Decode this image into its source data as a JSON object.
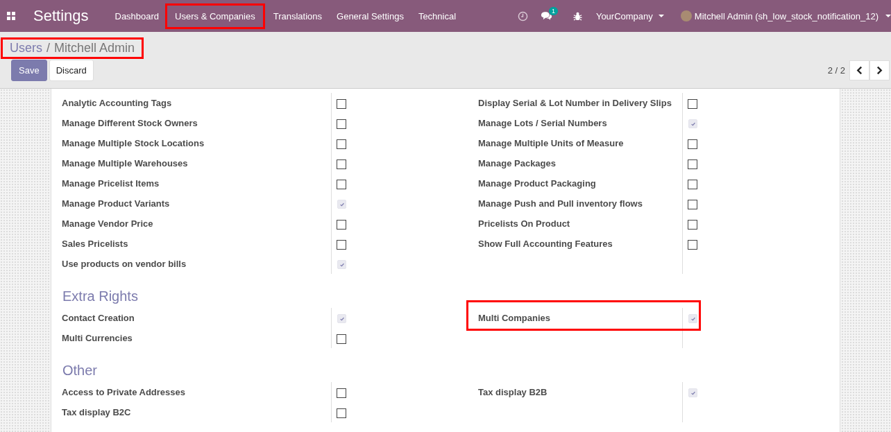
{
  "navbar": {
    "app_title": "Settings",
    "menu": [
      {
        "label": "Dashboard",
        "highlighted": false
      },
      {
        "label": "Users & Companies",
        "highlighted": true
      },
      {
        "label": "Translations",
        "highlighted": false
      },
      {
        "label": "General Settings",
        "highlighted": false
      },
      {
        "label": "Technical",
        "highlighted": false
      }
    ],
    "messages_badge": "1",
    "company": "YourCompany",
    "user": "Mitchell Admin (sh_low_stock_notification_12)"
  },
  "breadcrumb": {
    "items": [
      "Users",
      "Mitchell Admin"
    ],
    "separator": "/",
    "highlighted": true
  },
  "buttons": {
    "save": "Save",
    "discard": "Discard"
  },
  "pager": "2 / 2",
  "sections": [
    {
      "left": [
        {
          "label": "Analytic Accounting Tags",
          "checked": false,
          "highlighted": false
        },
        {
          "label": "Manage Different Stock Owners",
          "checked": false,
          "highlighted": false
        },
        {
          "label": "Manage Multiple Stock Locations",
          "checked": false,
          "highlighted": false
        },
        {
          "label": "Manage Multiple Warehouses",
          "checked": false,
          "highlighted": false
        },
        {
          "label": "Manage Pricelist Items",
          "checked": false,
          "highlighted": false
        },
        {
          "label": "Manage Product Variants",
          "checked": true,
          "highlighted": false
        },
        {
          "label": "Manage Vendor Price",
          "checked": false,
          "highlighted": false
        },
        {
          "label": "Sales Pricelists",
          "checked": false,
          "highlighted": false
        },
        {
          "label": "Use products on vendor bills",
          "checked": true,
          "highlighted": false
        }
      ],
      "right": [
        {
          "label": "Display Serial & Lot Number in Delivery Slips",
          "checked": false,
          "highlighted": false
        },
        {
          "label": "Manage Lots / Serial Numbers",
          "checked": true,
          "highlighted": false
        },
        {
          "label": "Manage Multiple Units of Measure",
          "checked": false,
          "highlighted": false
        },
        {
          "label": "Manage Packages",
          "checked": false,
          "highlighted": false
        },
        {
          "label": "Manage Product Packaging",
          "checked": false,
          "highlighted": false
        },
        {
          "label": "Manage Push and Pull inventory flows",
          "checked": false,
          "highlighted": false
        },
        {
          "label": "Pricelists On Product",
          "checked": false,
          "highlighted": false
        },
        {
          "label": "Show Full Accounting Features",
          "checked": false,
          "highlighted": false
        }
      ]
    },
    {
      "title": "Extra Rights",
      "left": [
        {
          "label": "Contact Creation",
          "checked": true,
          "highlighted": false
        },
        {
          "label": "Multi Currencies",
          "checked": false,
          "highlighted": false
        }
      ],
      "right": [
        {
          "label": "Multi Companies",
          "checked": true,
          "highlighted": true
        }
      ]
    },
    {
      "title": "Other",
      "left": [
        {
          "label": "Access to Private Addresses",
          "checked": false,
          "highlighted": false
        },
        {
          "label": "Tax display B2C",
          "checked": false,
          "highlighted": false
        }
      ],
      "right": [
        {
          "label": "Tax display B2B",
          "checked": true,
          "highlighted": false
        }
      ]
    }
  ]
}
